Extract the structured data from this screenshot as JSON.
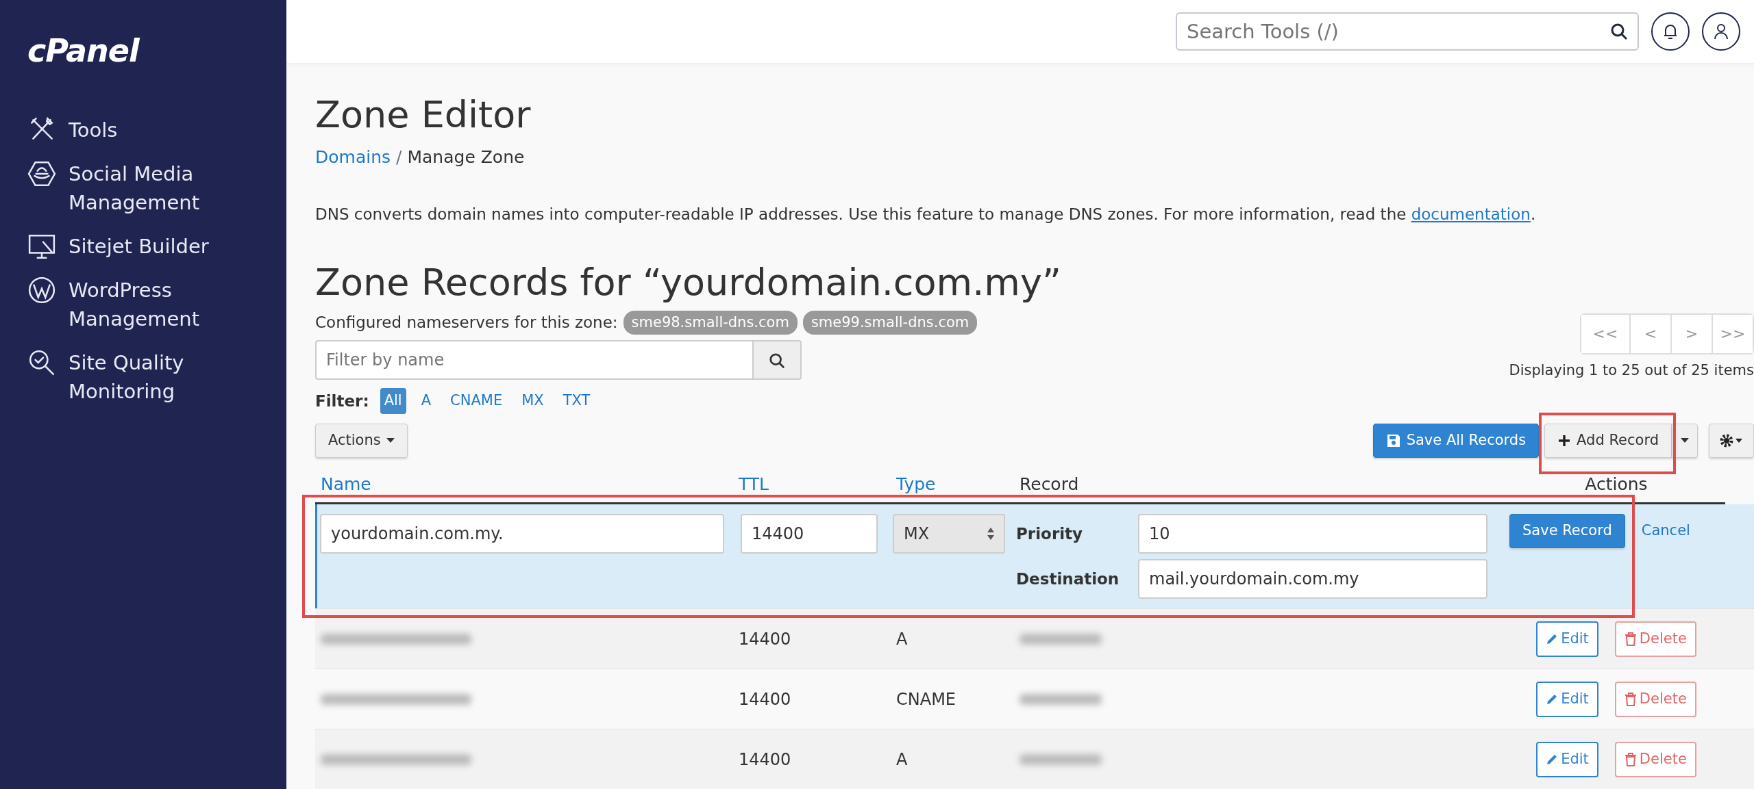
{
  "brand": "cPanel",
  "sidebar": {
    "items": [
      {
        "label": "Tools",
        "kind": "tools"
      },
      {
        "label": "Social Media Management",
        "kind": "social"
      },
      {
        "label": "Sitejet Builder",
        "kind": "sitejet"
      },
      {
        "label": "WordPress Management",
        "kind": "wordpress"
      },
      {
        "label": "Site Quality Monitoring",
        "kind": "quality"
      }
    ]
  },
  "header": {
    "search": {
      "placeholder": "Search Tools (/)"
    }
  },
  "page": {
    "title": "Zone Editor",
    "breadcrumb_separator": "/",
    "breadcrumb": [
      {
        "label": "Domains",
        "link": true
      },
      {
        "label": "Manage Zone",
        "link": false
      }
    ],
    "description": "DNS converts domain names into computer-readable IP addresses. Use this feature to manage DNS zones. For more information, read the ",
    "description_link": "documentation",
    "description_end": ".",
    "zone_title": "Zone Records for “yourdomain.com.my”",
    "nameservers_label": "Configured nameservers for this zone:",
    "nameservers": [
      "sme98.small-dns.com",
      "sme99.small-dns.com"
    ],
    "filter_search": {
      "placeholder": "Filter by name"
    },
    "filter_label": "Filter:",
    "filters": [
      {
        "label": "All",
        "selected": true
      },
      {
        "label": "A",
        "selected": false
      },
      {
        "label": "CNAME",
        "selected": false
      },
      {
        "label": "MX",
        "selected": false
      },
      {
        "label": "TXT",
        "selected": false
      }
    ],
    "pager": [
      "<<",
      "<",
      ">",
      ">>"
    ],
    "displaying": "Displaying 1 to 25 out of 25 items",
    "actions_button": "Actions",
    "save_all_button": "Save All Records",
    "add_record_button": {
      "label": "Add Record",
      "highlighted": true
    }
  },
  "table": {
    "columns": [
      {
        "label": "Name",
        "sortable": true
      },
      {
        "label": "TTL",
        "sortable": true
      },
      {
        "label": "Type",
        "sortable": true
      },
      {
        "label": "Record",
        "sortable": false
      },
      {
        "label": "Actions",
        "sortable": false
      }
    ],
    "edit_row": {
      "highlighted": true,
      "name": "yourdomain.com.my.",
      "ttl": "14400",
      "type": "MX",
      "priority_label": "Priority",
      "priority": "10",
      "destination_label": "Destination",
      "destination": "mail.yourdomain.com.my",
      "save": "Save Record",
      "cancel": "Cancel"
    },
    "rows": [
      {
        "ttl": "14400",
        "type": "A",
        "edit": "Edit",
        "delete": "Delete"
      },
      {
        "ttl": "14400",
        "type": "CNAME",
        "edit": "Edit",
        "delete": "Delete"
      },
      {
        "ttl": "14400",
        "type": "A",
        "edit": "Edit",
        "delete": "Delete"
      }
    ]
  }
}
